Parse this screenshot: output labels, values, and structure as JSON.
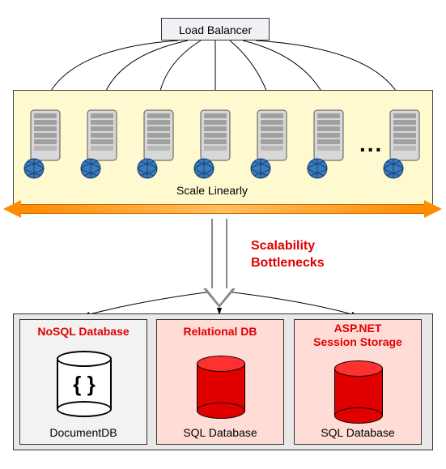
{
  "load_balancer": "Load Balancer",
  "scale_label": "Scale Linearly",
  "bottleneck_label_line1": "Scalability",
  "bottleneck_label_line2": "Bottlenecks",
  "dots": "...",
  "db": {
    "nosql": {
      "title": "NoSQL Database",
      "caption": "DocumentDB",
      "braces": "{ }"
    },
    "relational": {
      "title": "Relational DB",
      "caption": "SQL Database"
    },
    "asp": {
      "title_line1": "ASP.NET",
      "title_line2": "Session Storage",
      "caption": "SQL Database"
    }
  },
  "colors": {
    "red": "#e00000",
    "server_band_bg": "#fff9d0",
    "db_pink": "#ffdcd6",
    "arrow_orange": "#ff8c00"
  },
  "chart_data": {
    "type": "diagram",
    "nodes": [
      {
        "id": "lb",
        "label": "Load Balancer"
      },
      {
        "id": "server1",
        "type": "web-server"
      },
      {
        "id": "server2",
        "type": "web-server"
      },
      {
        "id": "server3",
        "type": "web-server"
      },
      {
        "id": "server4",
        "type": "web-server"
      },
      {
        "id": "server5",
        "type": "web-server"
      },
      {
        "id": "server6",
        "type": "web-server"
      },
      {
        "id": "serverN",
        "type": "web-server",
        "ellipsis_before": true
      },
      {
        "id": "nosql",
        "label": "NoSQL Database",
        "caption": "DocumentDB"
      },
      {
        "id": "reldb",
        "label": "Relational DB",
        "caption": "SQL Database"
      },
      {
        "id": "aspnet",
        "label": "ASP.NET Session Storage",
        "caption": "SQL Database"
      }
    ],
    "edges": [
      {
        "from": "lb",
        "to": "server1"
      },
      {
        "from": "lb",
        "to": "server2"
      },
      {
        "from": "lb",
        "to": "server3"
      },
      {
        "from": "lb",
        "to": "server4"
      },
      {
        "from": "lb",
        "to": "server5"
      },
      {
        "from": "lb",
        "to": "server6"
      },
      {
        "from": "lb",
        "to": "serverN"
      },
      {
        "from": "servers",
        "to": "nosql",
        "label": "Scalability Bottlenecks"
      },
      {
        "from": "servers",
        "to": "reldb",
        "label": "Scalability Bottlenecks"
      },
      {
        "from": "servers",
        "to": "aspnet",
        "label": "Scalability Bottlenecks"
      }
    ],
    "groups": [
      {
        "id": "servers",
        "label": "Scale Linearly",
        "members": [
          "server1",
          "server2",
          "server3",
          "server4",
          "server5",
          "server6",
          "serverN"
        ]
      }
    ]
  }
}
